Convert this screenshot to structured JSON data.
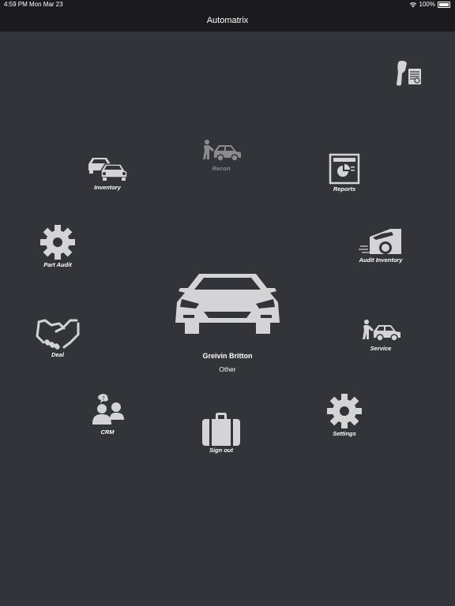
{
  "status": {
    "time": "4:59 PM",
    "date": "Mon Mar 23",
    "battery": "100%"
  },
  "header": {
    "title": "Automatrix"
  },
  "user": {
    "name": "Greivin Britton",
    "role": "Other"
  },
  "menu": {
    "recon": "Recon",
    "inventory": "Inventory",
    "reports": "Reports",
    "part_audit": "Part Audit",
    "audit_inventory": "Audit Inventory",
    "deal": "Deal",
    "service": "Service",
    "crm": "CRM",
    "settings": "Settings",
    "sign_out": "Sign out"
  },
  "colors": {
    "background": "#33333a",
    "bar": "#1b1b1e",
    "icon": "#d4d4d6",
    "disabled": "#8a8a8f"
  },
  "icons": {
    "scanner": "barcode-scanner-icon",
    "recon": "mechanic-car-icon",
    "inventory": "cars-icon",
    "reports": "report-icon",
    "part_audit": "gear-icon",
    "audit_inventory": "open-trunk-car-icon",
    "deal": "handshake-icon",
    "service": "mechanic-car-icon",
    "crm": "people-icon",
    "settings": "gear-icon",
    "sign_out": "briefcase-icon",
    "avatar": "sports-car-icon"
  }
}
